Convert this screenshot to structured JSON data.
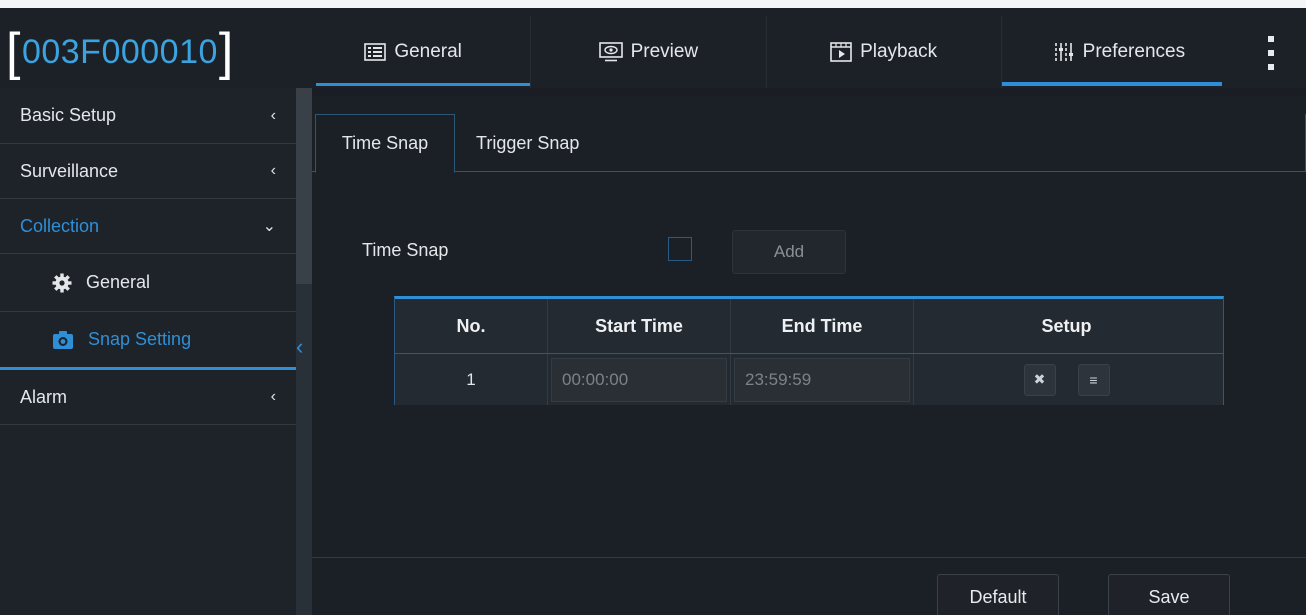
{
  "header": {
    "bracket_open": "[",
    "device_id": "003F000010",
    "bracket_close": "]",
    "tabs": [
      {
        "label": "General",
        "icon": "list-grid-icon"
      },
      {
        "label": "Preview",
        "icon": "eye-monitor-icon"
      },
      {
        "label": "Playback",
        "icon": "playback-icon"
      },
      {
        "label": "Preferences",
        "icon": "sliders-icon"
      }
    ],
    "active_tab": "Preferences",
    "accent": "#2f8fd6"
  },
  "sidebar": {
    "items": [
      {
        "label": "Basic Setup",
        "chevron": "‹"
      },
      {
        "label": "Surveillance",
        "chevron": "‹"
      },
      {
        "label": "Collection",
        "chevron": "⌄"
      },
      {
        "label": "Alarm",
        "chevron": "‹"
      }
    ],
    "sub_items": [
      {
        "label": "General",
        "icon": "gear-icon"
      },
      {
        "label": "Snap Setting",
        "icon": "camera-icon"
      }
    ],
    "collapse_glyph": "‹"
  },
  "main": {
    "tabs": [
      {
        "label": "Time Snap"
      },
      {
        "label": "Trigger Snap"
      }
    ],
    "time_snap_label": "Time Snap",
    "add_label": "Add",
    "table": {
      "headers": [
        "No.",
        "Start Time",
        "End Time",
        "Setup"
      ],
      "rows": [
        {
          "no": "1",
          "start": "00:00:00",
          "end": "23:59:59"
        }
      ]
    },
    "delete_glyph": "✖",
    "menu_glyph": "≡",
    "default_label": "Default",
    "save_label": "Save"
  }
}
